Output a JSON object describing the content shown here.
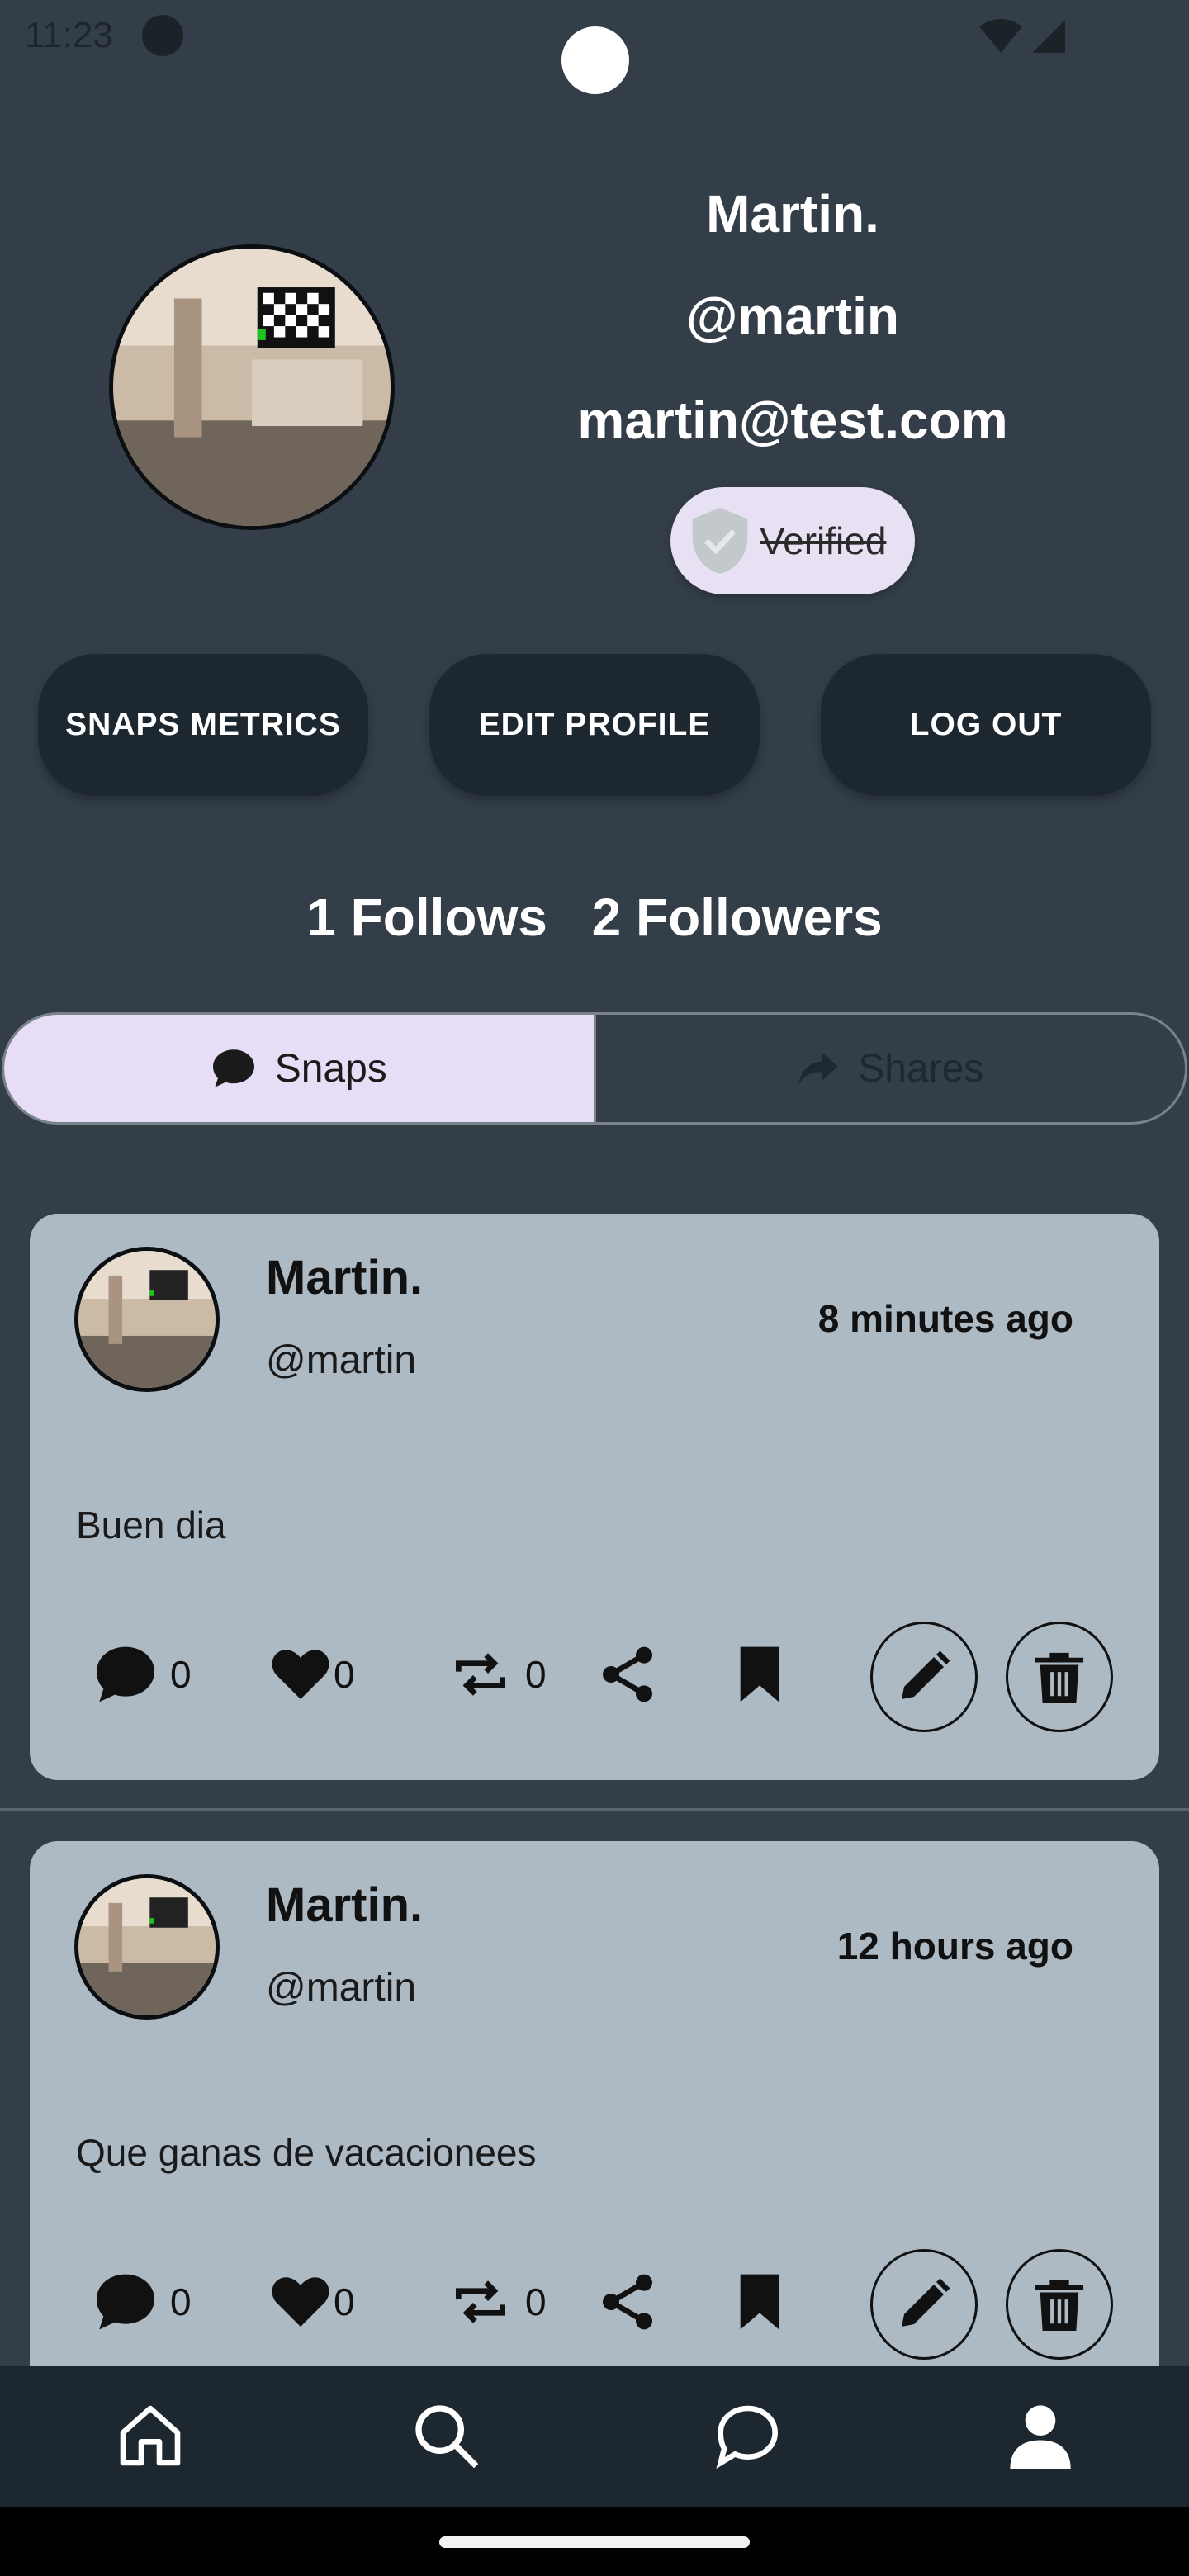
{
  "status_bar": {
    "time": "11:23"
  },
  "profile": {
    "name": "Martin.",
    "handle": "@martin",
    "email": "martin@test.com",
    "verified_label": "Verified"
  },
  "actions": {
    "metrics_label": "SNAPS METRICS",
    "edit_label": "EDIT PROFILE",
    "logout_label": "LOG OUT"
  },
  "stats": {
    "follows": "1 Follows",
    "followers": "2 Followers"
  },
  "tabs": [
    {
      "label": "Snaps",
      "icon": "chat-bubble-icon",
      "active": true
    },
    {
      "label": "Shares",
      "icon": "share-arrow-icon",
      "active": false
    }
  ],
  "snaps": [
    {
      "name": "Martin.",
      "handle": "@martin",
      "time": "8 minutes ago",
      "text": "Buen dia",
      "comments": "0",
      "likes": "0",
      "reposts": "0"
    },
    {
      "name": "Martin.",
      "handle": "@martin",
      "time": "12 hours ago",
      "text": "Que ganas de vacacionees",
      "comments": "0",
      "likes": "0",
      "reposts": "0"
    }
  ],
  "nav": [
    "home-icon",
    "search-icon",
    "messages-icon",
    "profile-icon"
  ],
  "colors": {
    "background": "#333e49",
    "card": "#adbac4",
    "button": "#1d272f",
    "tab_active": "#e8ddf6"
  }
}
